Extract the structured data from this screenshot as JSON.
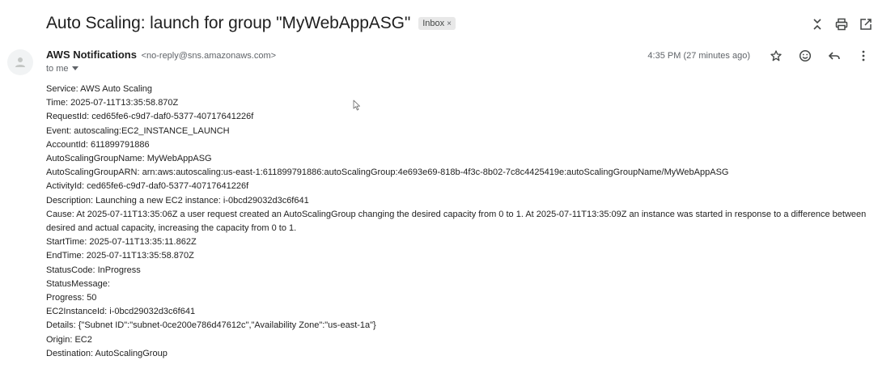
{
  "header": {
    "subject": "Auto Scaling: launch for group \"MyWebAppASG\"",
    "label_chip": "Inbox",
    "label_remove": "×",
    "icons": [
      "expand-collapse-icon",
      "print-icon",
      "open-new-window-icon"
    ]
  },
  "message": {
    "sender_name": "AWS Notifications",
    "sender_email": "<no-reply@sns.amazonaws.com>",
    "to_line": "to me",
    "timestamp": "4:35 PM (27 minutes ago)",
    "icons": [
      "star-icon",
      "emoji-icon",
      "reply-icon",
      "more-vertical-icon"
    ]
  },
  "body": {
    "lines": [
      "Service: AWS Auto Scaling",
      "Time: 2025-07-11T13:35:58.870Z",
      "RequestId: ced65fe6-c9d7-daf0-5377-40717641226f",
      "Event: autoscaling:EC2_INSTANCE_LAUNCH",
      "AccountId: 611899791886",
      "AutoScalingGroupName: MyWebAppASG",
      "AutoScalingGroupARN: arn:aws:autoscaling:us-east-1:611899791886:autoScalingGroup:4e693e69-818b-4f3c-8b02-7c8c4425419e:autoScalingGroupName/MyWebAppASG",
      "ActivityId: ced65fe6-c9d7-daf0-5377-40717641226f",
      "Description: Launching a new EC2 instance: i-0bcd29032d3c6f641",
      "Cause: At 2025-07-11T13:35:06Z a user request created an AutoScalingGroup changing the desired capacity from 0 to 1.  At 2025-07-11T13:35:09Z an instance was started in response to a difference between desired and actual capacity, increasing the capacity from 0 to 1.",
      "StartTime: 2025-07-11T13:35:11.862Z",
      "EndTime: 2025-07-11T13:35:58.870Z",
      "StatusCode: InProgress",
      "StatusMessage:",
      "Progress: 50",
      "EC2InstanceId: i-0bcd29032d3c6f641",
      "Details: {\"Subnet ID\":\"subnet-0ce200e786d47612c\",\"Availability Zone\":\"us-east-1a\"}",
      "Origin: EC2",
      "Destination: AutoScalingGroup"
    ]
  }
}
